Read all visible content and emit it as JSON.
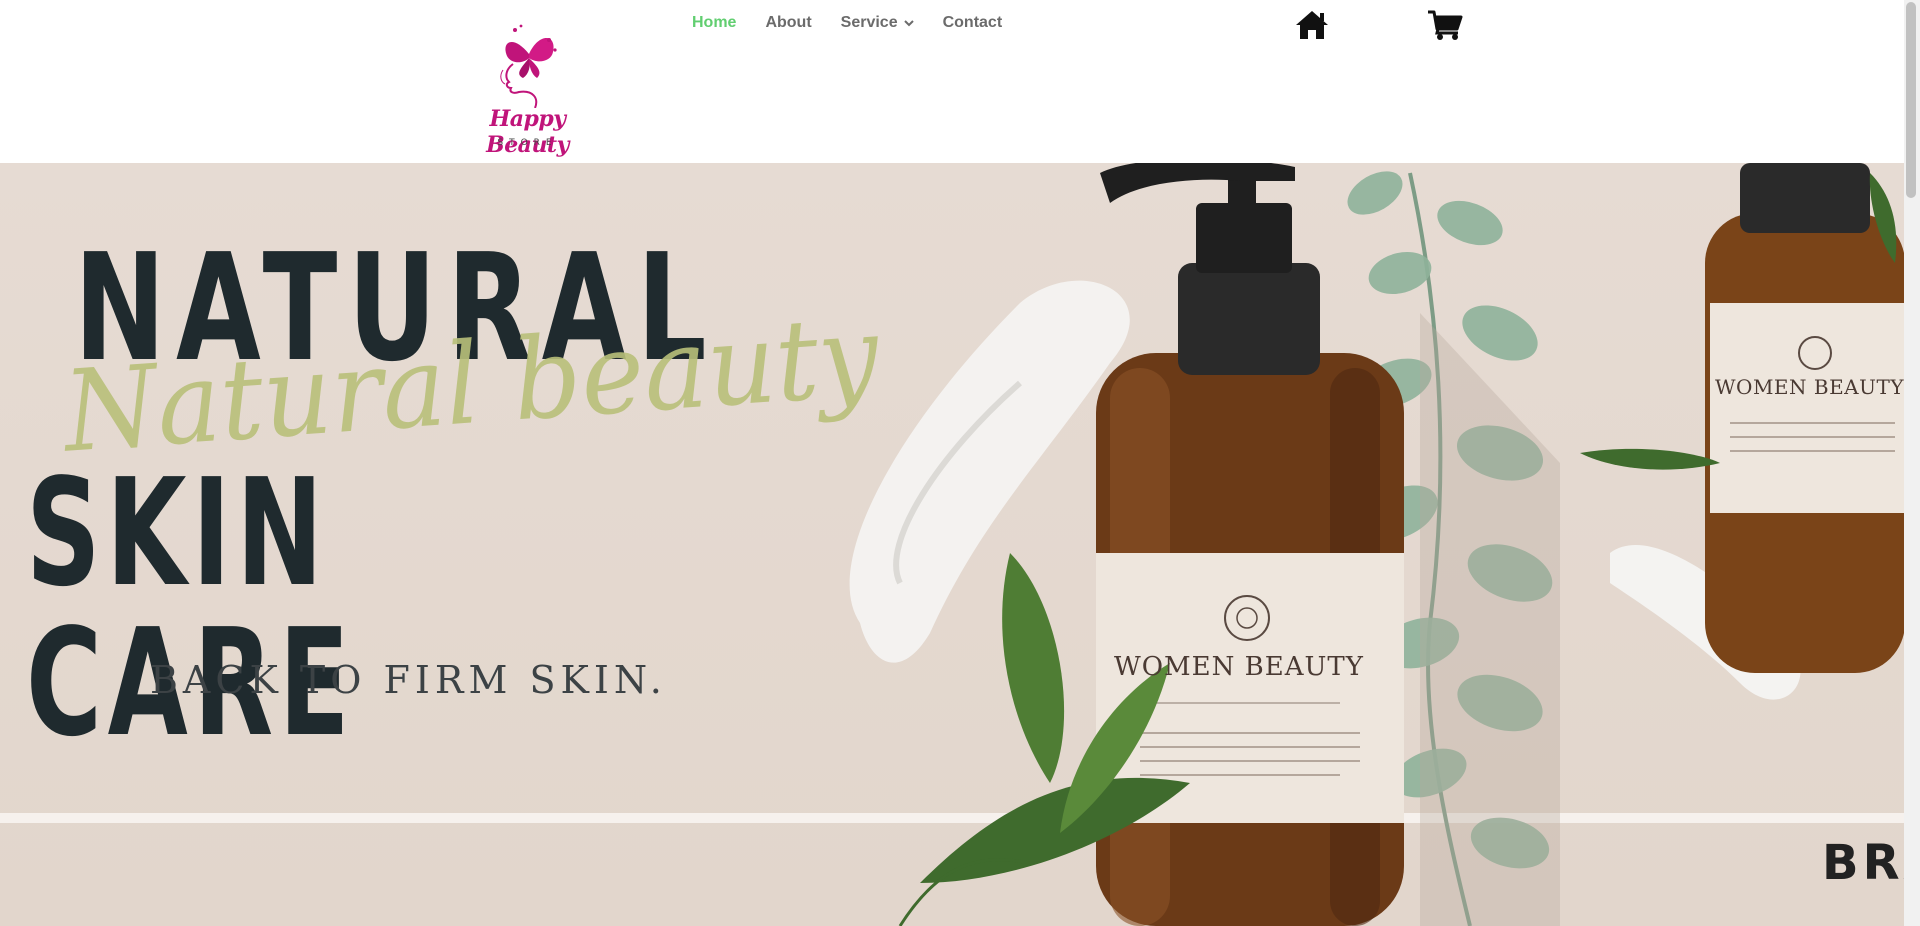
{
  "logo": {
    "brand": "Happy Beauty",
    "subtitle": "STORE",
    "color": "#c0147a"
  },
  "nav": {
    "items": [
      {
        "label": "Home"
      },
      {
        "label": "About"
      },
      {
        "label": "Service"
      },
      {
        "label": "Contact"
      }
    ],
    "active_color": "#61ce70",
    "text_color": "#6b6b6b"
  },
  "header_icons": {
    "home": "home-icon",
    "cart": "cart-icon"
  },
  "hero": {
    "headline_1": "NATURAL",
    "script": "Natural beauty",
    "headline_2": "SKIN CARE",
    "tagline": "BACK TO FIRM SKIN.",
    "product_label": "WOMEN BEAUTY",
    "product_label_small": "WOMEN BEAUTY",
    "brand_partial": "BRA",
    "background": "#e4d8ce"
  }
}
